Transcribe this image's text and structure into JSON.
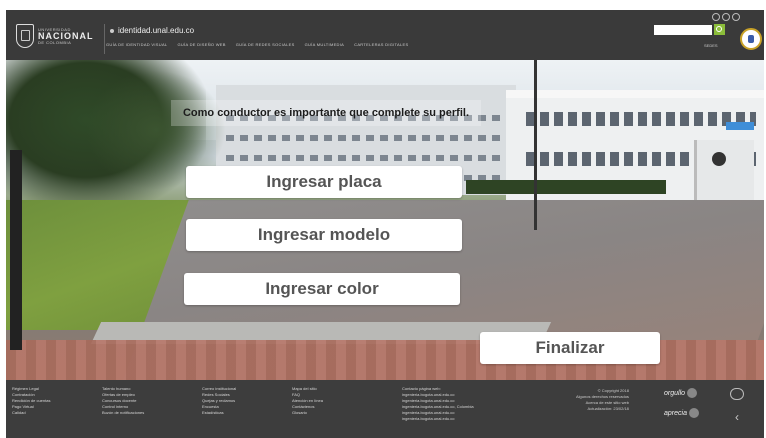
{
  "header": {
    "logo_small": "UNIVERSIDAD",
    "logo_big": "NACIONAL",
    "logo_sub": "DE COLOMBIA",
    "domain": "identidad.unal.edu.co",
    "nav": [
      "GUÍA DE IDENTIDAD VISUAL",
      "GUÍA DE DISEÑO WEB",
      "GUÍA DE REDES SOCIALES",
      "GUÍA MULTIMEDIA",
      "CARTELERAS DIGITALES"
    ],
    "search_placeholder": "",
    "sites_label": "SEDES"
  },
  "main": {
    "prompt": "Como conductor es importante que complete su perfil.",
    "buttons": {
      "plate": "Ingresar placa",
      "model": "Ingresar modelo",
      "color": "Ingresar color",
      "finish": "Finalizar"
    }
  },
  "footer": {
    "col1": [
      "Régimen Legal",
      "Contratación",
      "Rendición de cuentas",
      "Pago Virtual",
      "Calidad"
    ],
    "col2": [
      "Talento humano",
      "Ofertas de empleo",
      "Concursos docente",
      "Control interno",
      "Buzón de notificaciones"
    ],
    "col3": [
      "Correo institucional",
      "Redes Sociales",
      "Quejas y reclamos",
      "Encuesta",
      "Estadísticas"
    ],
    "col4": [
      "Mapa del sitio",
      "FAQ",
      "Atención en línea",
      "Contáctenos",
      "Glosario"
    ],
    "col5": [
      "Contacto página web:",
      "ingenieria.bogota.unal.edu.co",
      "ingenieria.bogota.unal.edu.co",
      "ingenieria.bogota.unal.edu.co, Colombia",
      "ingenieria.bogota.unal.edu.co",
      "ingenieria.bogota.unal.edu.co"
    ],
    "copyright": [
      "© Copyright 2018",
      "Algunos derechos reservados",
      "Acerca de este sitio web",
      "Actualización: 23/02/18"
    ],
    "badge1": "orgullo",
    "badge2": "aprecia"
  }
}
